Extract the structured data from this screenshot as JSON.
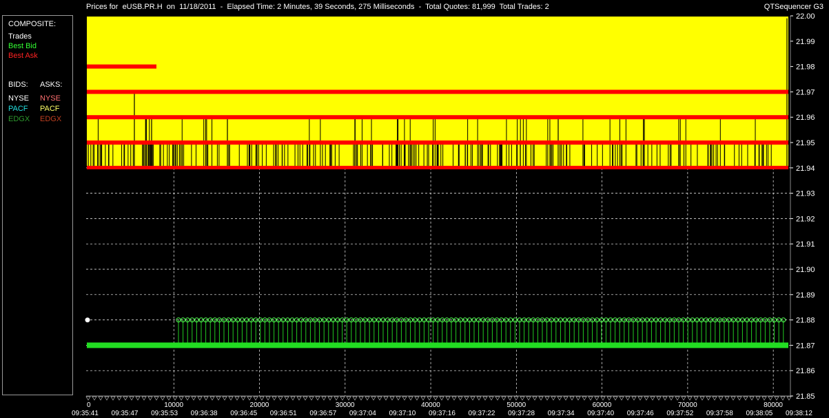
{
  "header": {
    "title": "Prices for  eUSB.PR.H  on  11/18/2011  -  Elapsed Time: 2 Minutes, 39 Seconds, 275 Milliseconds  -  Total Quotes: 81,999  Total Trades: 2",
    "app_name": "QTSequencer G3"
  },
  "legend": {
    "composite_label": "COMPOSITE:",
    "trades_label": "Trades",
    "best_bid_label": "Best Bid",
    "best_ask_label": "Best Ask",
    "bids_label": "BIDS:",
    "asks_label": "ASKS:",
    "bids": [
      "NYSE",
      "PACF",
      "EDGX"
    ],
    "asks": [
      "NYSE",
      "PACF",
      "EDGX"
    ],
    "colors": {
      "trades": "#ffffff",
      "best_bid": "#33ff33",
      "best_ask": "#ff2222",
      "bid_nyse": "#ffffff",
      "bid_pacf": "#22e0e0",
      "bid_edgx": "#2e9a2e",
      "ask_nyse": "#ff7070",
      "ask_pacf": "#ffff66",
      "ask_edgx": "#c04020"
    }
  },
  "chart_data": {
    "type": "line",
    "y_ticks": [
      "22.00",
      "21.99",
      "21.98",
      "21.97",
      "21.96",
      "21.95",
      "21.94",
      "21.93",
      "21.92",
      "21.91",
      "21.90",
      "21.89",
      "21.88",
      "21.87",
      "21.86",
      "21.85"
    ],
    "ylim": [
      21.85,
      22.0
    ],
    "xlim": [
      0,
      82000
    ],
    "x_ticks": [
      "0",
      "10000",
      "20000",
      "30000",
      "40000",
      "50000",
      "60000",
      "70000",
      "80000"
    ],
    "time_labels": [
      "09:35:41",
      "09:35:47",
      "09:35:53",
      "09:36:38",
      "09:36:45",
      "09:36:51",
      "09:36:57",
      "09:37:04",
      "09:37:10",
      "09:37:16",
      "09:37:22",
      "09:37:28",
      "09:37:34",
      "09:37:40",
      "09:37:46",
      "09:37:52",
      "09:37:58",
      "09:38:05",
      "09:38:12"
    ],
    "grid": true,
    "ask_levels": [
      21.98,
      21.97,
      21.96,
      21.95,
      21.94
    ],
    "best_bid": 21.87,
    "bid_spike_level": 21.88,
    "trades": [
      {
        "x": 0,
        "y": 21.88
      }
    ],
    "colors": {
      "background": "#000000",
      "ask_fill": "#ffff00",
      "ask_line": "#ff0000",
      "bid_line": "#22dd22",
      "grid": "#ffffff"
    }
  }
}
